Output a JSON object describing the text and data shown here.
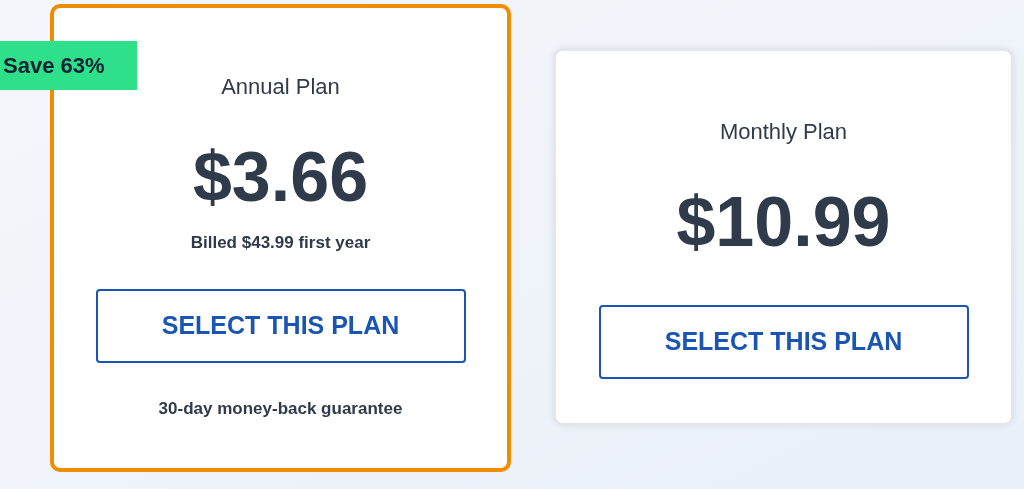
{
  "plans": [
    {
      "name": "Annual Plan",
      "price": "$3.66",
      "billed": "Billed $43.99 first year",
      "button": "SELECT THIS PLAN",
      "guarantee": "30-day money-back guarantee",
      "badge": "Save 63%",
      "selected": true
    },
    {
      "name": "Monthly Plan",
      "price": "$10.99",
      "button": "SELECT THIS PLAN",
      "selected": false
    }
  ]
}
